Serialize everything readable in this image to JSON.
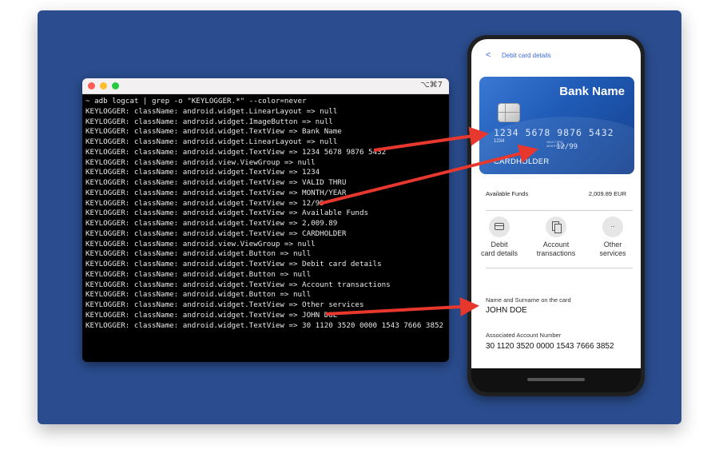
{
  "terminal": {
    "shortcut": "⌥⌘7",
    "lines": [
      "~ adb logcat | grep -o \"KEYLOGGER.*\" --color=never",
      "KEYLOGGER: className: android.widget.LinearLayout => null",
      "KEYLOGGER: className: android.widget.ImageButton => null",
      "KEYLOGGER: className: android.widget.TextView => Bank Name",
      "KEYLOGGER: className: android.widget.LinearLayout => null",
      "KEYLOGGER: className: android.widget.TextView => 1234 5678 9876 5432",
      "KEYLOGGER: className: android.view.ViewGroup => null",
      "KEYLOGGER: className: android.widget.TextView => 1234",
      "KEYLOGGER: className: android.widget.TextView => VALID THRU",
      "KEYLOGGER: className: android.widget.TextView => MONTH/YEAR",
      "KEYLOGGER: className: android.widget.TextView => 12/99",
      "KEYLOGGER: className: android.widget.TextView => Available Funds",
      "KEYLOGGER: className: android.widget.TextView => 2,009.89",
      "KEYLOGGER: className: android.widget.TextView => CARDHOLDER",
      "KEYLOGGER: className: android.view.ViewGroup => null",
      "KEYLOGGER: className: android.widget.Button => null",
      "KEYLOGGER: className: android.widget.TextView => Debit card details",
      "KEYLOGGER: className: android.widget.Button => null",
      "KEYLOGGER: className: android.widget.TextView => Account transactions",
      "KEYLOGGER: className: android.widget.Button => null",
      "KEYLOGGER: className: android.widget.TextView => Other services",
      "KEYLOGGER: className: android.widget.TextView => JOHN DOE",
      "KEYLOGGER: className: android.widget.TextView => 30 1120 3520 0000 1543 7666 3852"
    ]
  },
  "phone": {
    "header": {
      "back_icon": "<",
      "title": "Debit card details"
    },
    "card": {
      "bank_name": "Bank Name",
      "number": "1234 5678 9876 5432",
      "short_number": "1234",
      "valid_thru": "VALID THRU",
      "month_year": "MONTH/YEAR",
      "expiry": "12/99",
      "holder": "CARDHOLDER"
    },
    "funds": {
      "label": "Available Funds",
      "value": "2,009.89 EUR"
    },
    "actions": [
      {
        "line1": "Debit",
        "line2": "card details",
        "icon": "card-icon"
      },
      {
        "line1": "Account",
        "line2": "transactions",
        "icon": "documents-icon"
      },
      {
        "line1": "Other",
        "line2": "services",
        "icon": "more-icon",
        "glyph": ".."
      }
    ],
    "name_field": {
      "label": "Name and Surname on the card",
      "value": "JOHN DOE"
    },
    "account_field": {
      "label": "Associated Account Number",
      "value": "30 1120 3520 0000 1543 7666 3852"
    }
  },
  "colors": {
    "background_panel": "#2b4d8f",
    "arrow": "#e8382d",
    "link_blue": "#3f6ad8"
  }
}
